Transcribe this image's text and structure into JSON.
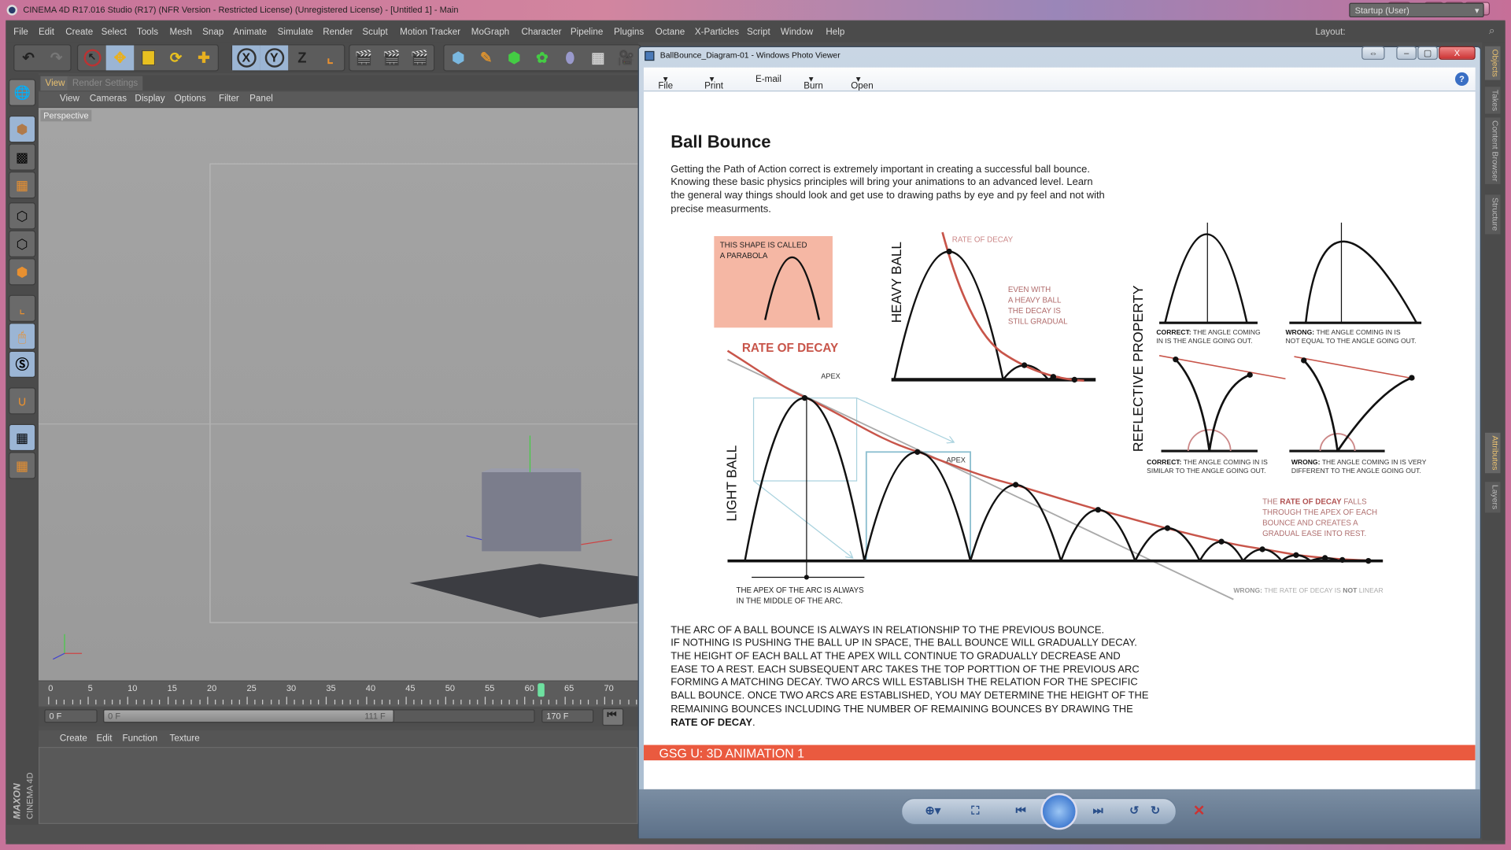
{
  "app": {
    "title": "CINEMA 4D R17.016 Studio (R17) (NFR Version - Restricted License) (Unregistered License) - [Untitled 1] - Main",
    "window_buttons": [
      "⇔",
      "–",
      "▢",
      "X"
    ]
  },
  "menubar": {
    "items": [
      "File",
      "Edit",
      "Create",
      "Select",
      "Tools",
      "Mesh",
      "Snap",
      "Animate",
      "Simulate",
      "Render",
      "Sculpt",
      "Motion Tracker",
      "MoGraph",
      "Character",
      "Pipeline",
      "Plugins",
      "Octane",
      "X-Particles",
      "Script",
      "Window",
      "Help"
    ],
    "layout_label": "Layout:",
    "layout_value": "Startup (User)"
  },
  "toolbar": {
    "icons": [
      "undo-icon",
      "redo-icon",
      "select-icon",
      "move-icon",
      "scale-icon",
      "rotate-icon",
      "add-icon",
      "x-axis-icon",
      "y-axis-icon",
      "z-axis-icon",
      "coordinate-system-icon",
      "render-view-icon",
      "render-picture-viewer-icon",
      "render-settings-icon",
      "cube-icon",
      "pen-icon",
      "subdivision-icon",
      "cloner-icon",
      "deformer-icon",
      "floor-icon",
      "camera-icon"
    ],
    "axis_labels": [
      "X",
      "Y",
      "Z"
    ]
  },
  "left_tools": [
    "make-editable-icon",
    "model-mode-icon",
    "texture-mode-icon",
    "workplane-icon",
    "points-mode-icon",
    "edges-mode-icon",
    "polygons-mode-icon",
    "axis-mode-icon",
    "tweak-mode-icon",
    "solo-icon",
    "snap-icon",
    "lock-workplane-icon",
    "align-workplane-icon"
  ],
  "viewport": {
    "tabs": [
      "View",
      "Render Settings"
    ],
    "active_tab": "View",
    "menu": [
      "View",
      "Cameras",
      "Display",
      "Options",
      "Filter",
      "Panel"
    ],
    "camera_label": "Perspective"
  },
  "timeline": {
    "ticks": [
      "0",
      "5",
      "10",
      "15",
      "20",
      "25",
      "30",
      "35",
      "40",
      "45",
      "50",
      "55",
      "60",
      "65",
      "70"
    ],
    "current_frame": 62,
    "start_field": "0 F",
    "range_start": "0 F",
    "range_end": "111 F",
    "end_field": "170 F"
  },
  "material_panel": {
    "menu": [
      "Create",
      "Edit",
      "Function",
      "Texture"
    ]
  },
  "branding": {
    "maxon": "MAXON",
    "product": "CINEMA 4D"
  },
  "right_dock": {
    "tabs": [
      "Objects",
      "Takes",
      "Content Browser",
      "Structure",
      "Attributes",
      "Layers"
    ]
  },
  "photo_viewer": {
    "title": "BallBounce_Diagram-01 - Windows Photo Viewer",
    "menu": [
      "File",
      "Print",
      "E-mail",
      "Burn",
      "Open"
    ],
    "help": "?",
    "controls": [
      "zoom-icon",
      "actual-size-icon",
      "previous-icon",
      "slideshow-icon",
      "next-icon",
      "rotate-ccw-icon",
      "rotate-cw-icon",
      "delete-icon"
    ]
  },
  "diagram": {
    "title": "Ball Bounce",
    "intro": [
      "Getting the Path of Action correct is extremely important in creating a successful ball bounce.",
      "Knowing these basic physics principles will bring your animations to an advanced level. Learn",
      "the general way things should look and get use to drawing paths by eye and py feel and not with",
      "precise measurments."
    ],
    "parabola_note": [
      "THIS SHAPE IS CALLED",
      "A PARABOLA"
    ],
    "rate_of_decay": "RATE OF DECAY",
    "heavy_ball": "HEAVY BALL",
    "heavy_rate_label": "RATE OF DECAY",
    "heavy_note": [
      "EVEN WITH",
      "A HEAVY BALL",
      "THE DECAY IS",
      "STILL GRADUAL"
    ],
    "light_ball": "LIGHT BALL",
    "apex": "APEX",
    "apex_note": [
      "THE APEX OF THE ARC IS ALWAYS",
      "IN THE MIDDLE OF THE ARC."
    ],
    "wrong_linear": {
      "bold": "WRONG:",
      "text": "THE RATE OF DECAY IS",
      "bold2": "NOT",
      "text2": "LINEAR"
    },
    "decay_note": {
      "l1a": "THE",
      "l1b": "RATE OF DECAY",
      "l1c": "FALLS",
      "lines": [
        "THROUGH THE APEX OF EACH",
        "BOUNCE AND CREATES A",
        "GRADUAL EASE INTO REST."
      ]
    },
    "reflective": "REFLECTIVE PROPERTY",
    "captions": [
      {
        "bold": "CORRECT:",
        "l1": "THE ANGLE COMING",
        "l2": "IN IS THE ANGLE GOING OUT."
      },
      {
        "bold": "WRONG:",
        "l1": "THE ANGLE COMING IN IS",
        "l2": "NOT EQUAL TO THE ANGLE GOING OUT."
      },
      {
        "bold": "CORRECT:",
        "l1": "THE ANGLE COMING IN IS",
        "l2": "SIMILAR TO THE ANGLE GOING OUT."
      },
      {
        "bold": "WRONG:",
        "l1": "THE ANGLE COMING IN IS VERY",
        "l2": "DIFFERENT TO THE ANGLE GOING OUT."
      }
    ],
    "body": [
      "THE ARC OF A BALL BOUNCE IS ALWAYS IN RELATIONSHIP TO THE PREVIOUS BOUNCE.",
      "IF NOTHING IS PUSHING THE BALL UP IN SPACE, THE BALL BOUNCE WILL GRADUALLY DECAY.",
      "THE HEIGHT OF EACH BALL AT THE APEX WILL CONTINUE TO GRADUALLY DECREASE AND",
      "EASE TO A REST. EACH SUBSEQUENT ARC TAKES THE TOP PORTTION OF THE PREVIOUS ARC",
      "FORMING A MATCHING DECAY. TWO ARCS WILL ESTABLISH THE RELATION FOR THE SPECIFIC",
      "BALL BOUNCE. ONCE TWO ARCS ARE ESTABLISHED, YOU MAY DETERMINE THE HEIGHT OF THE",
      "REMAINING BOUNCES INCLUDING THE NUMBER OF REMAINING BOUNCES BY DRAWING THE"
    ],
    "body_last_bold": "RATE OF DECAY",
    "body_last_end": ".",
    "footer": "GSG U: 3D ANIMATION 1",
    "colors": {
      "accent_red": "#c8554a",
      "pink_box": "#f5b7a4",
      "footer_band": "#ea5a3f",
      "guide_blue": "#a9d2de"
    }
  }
}
